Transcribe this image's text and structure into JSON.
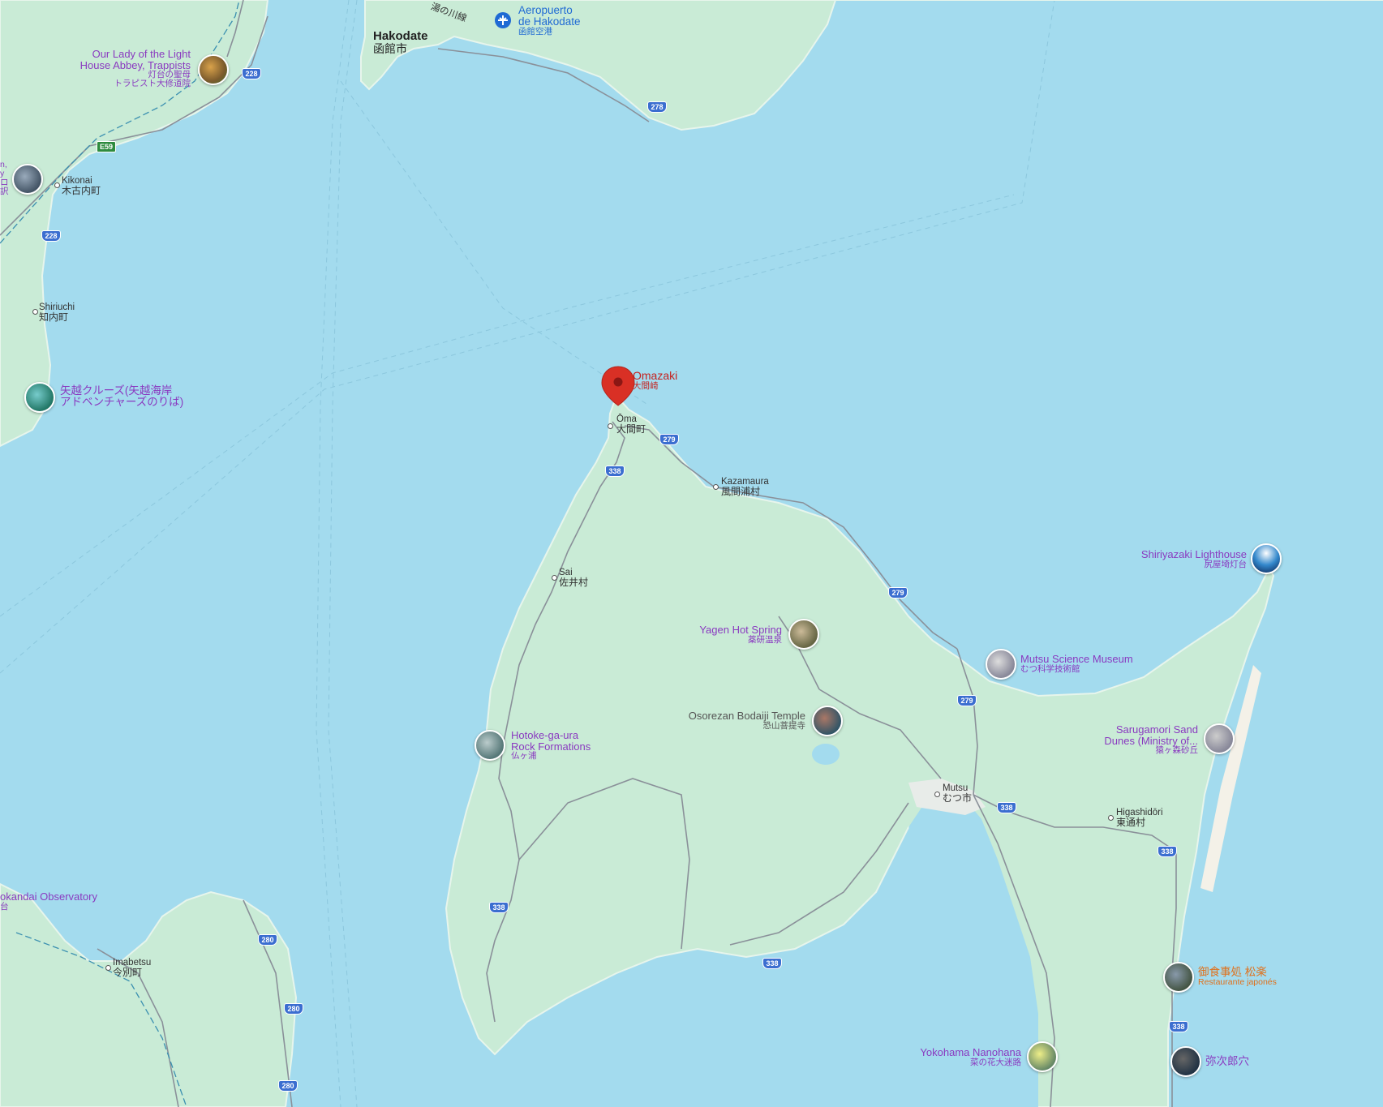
{
  "map": {
    "selected_pin": {
      "name": "Omazaki",
      "name_ja": "大間崎",
      "icon": "red-location-pin"
    },
    "colors": {
      "water": "#a3dbee",
      "land": "#c9ebd6",
      "pin": "#d93025",
      "road": "#8a9099",
      "poi_text": "#8a3ac0"
    },
    "places": [
      {
        "id": "hakodate",
        "en": "Hakodate",
        "ja": "函館市",
        "kind": "city"
      },
      {
        "id": "yunokawa",
        "en": "湯の川線",
        "ja": "",
        "kind": "town"
      },
      {
        "id": "airport",
        "en": "Aeropuerto",
        "en2": "de Hakodate",
        "ja": "函館空港",
        "kind": "airport",
        "icon": "airplane-icon"
      },
      {
        "id": "trappists",
        "en": "Our Lady of the Light",
        "en2": "House Abbey, Trappists",
        "ja": "灯台の聖母",
        "ja2": "トラピスト大修道院",
        "kind": "poi",
        "icon": "photo-thumbnail"
      },
      {
        "id": "kikonai",
        "en": "Kikonai",
        "ja": "木古内町",
        "kind": "town"
      },
      {
        "id": "shiriuchi",
        "en": "Shiriuchi",
        "ja": "知内町",
        "kind": "town"
      },
      {
        "id": "yagoshi",
        "en": "矢越クルーズ(矢越海岸",
        "ja": "アドベンチャーズのりば)",
        "kind": "poi",
        "icon": "photo-thumbnail"
      },
      {
        "id": "left-cut",
        "en": "n,",
        "en2": "y",
        "ja": "ロ",
        "ja2": "訳",
        "kind": "poi",
        "icon": "photo-thumbnail"
      },
      {
        "id": "ooma",
        "en": "Ōma",
        "ja": "大間町",
        "kind": "town"
      },
      {
        "id": "kazamaura",
        "en": "Kazamaura",
        "ja": "風間浦村",
        "kind": "town"
      },
      {
        "id": "sai",
        "en": "Sai",
        "ja": "佐井村",
        "kind": "town"
      },
      {
        "id": "yagen",
        "en": "Yagen Hot Spring",
        "ja": "薬研温泉",
        "kind": "poi",
        "icon": "photo-thumbnail"
      },
      {
        "id": "osorezan",
        "en": "Osorezan Bodaiji Temple",
        "ja": "恐山菩提寺",
        "kind": "poi",
        "icon": "photo-thumbnail"
      },
      {
        "id": "hotoke",
        "en": "Hotoke-ga-ura",
        "en2": "Rock Formations",
        "ja": "仏ヶ浦",
        "kind": "poi",
        "icon": "photo-thumbnail"
      },
      {
        "id": "mutsu-museum",
        "en": "Mutsu Science Museum",
        "ja": "むつ科学技術館",
        "kind": "poi",
        "icon": "photo-thumbnail"
      },
      {
        "id": "shiriyazaki",
        "en": "Shiriyazaki Lighthouse",
        "ja": "尻屋埼灯台",
        "kind": "poi",
        "icon": "photo-thumbnail"
      },
      {
        "id": "sarugamori",
        "en": "Sarugamori Sand",
        "en2": "Dunes (Ministry of...",
        "ja": "猿ヶ森砂丘",
        "kind": "poi",
        "icon": "photo-thumbnail"
      },
      {
        "id": "mutsu",
        "en": "Mutsu",
        "ja": "むつ市",
        "kind": "town"
      },
      {
        "id": "higashidori",
        "en": "Higashidōri",
        "ja": "東通村",
        "kind": "town"
      },
      {
        "id": "tappi",
        "en": "okandai Observatory",
        "ja": "台",
        "kind": "poi"
      },
      {
        "id": "imabetsu",
        "en": "Imabetsu",
        "ja": "今別町",
        "kind": "town"
      },
      {
        "id": "matsuraku",
        "en": "御食事処 松楽",
        "ja": "Restaurante japonés",
        "kind": "resto",
        "icon": "photo-thumbnail"
      },
      {
        "id": "yokohama",
        "en": "Yokohama Nanohana",
        "ja": "菜の花大迷路",
        "kind": "poi",
        "icon": "photo-thumbnail"
      },
      {
        "id": "yajiro",
        "en": "弥次郎穴",
        "ja": "",
        "kind": "poi",
        "icon": "photo-thumbnail"
      }
    ],
    "road_shields": [
      {
        "id": "s228a",
        "label": "228"
      },
      {
        "id": "s228b",
        "label": "228"
      },
      {
        "id": "se59",
        "label": "E59"
      },
      {
        "id": "s278",
        "label": "278"
      },
      {
        "id": "s279a",
        "label": "279"
      },
      {
        "id": "s279b",
        "label": "279"
      },
      {
        "id": "s279c",
        "label": "279"
      },
      {
        "id": "s338a",
        "label": "338"
      },
      {
        "id": "s338b",
        "label": "338"
      },
      {
        "id": "s338c",
        "label": "338"
      },
      {
        "id": "s338d",
        "label": "338"
      },
      {
        "id": "s338e",
        "label": "338"
      },
      {
        "id": "s338f",
        "label": "338"
      },
      {
        "id": "s280a",
        "label": "280"
      },
      {
        "id": "s280b",
        "label": "280"
      },
      {
        "id": "s280c",
        "label": "280"
      }
    ]
  }
}
